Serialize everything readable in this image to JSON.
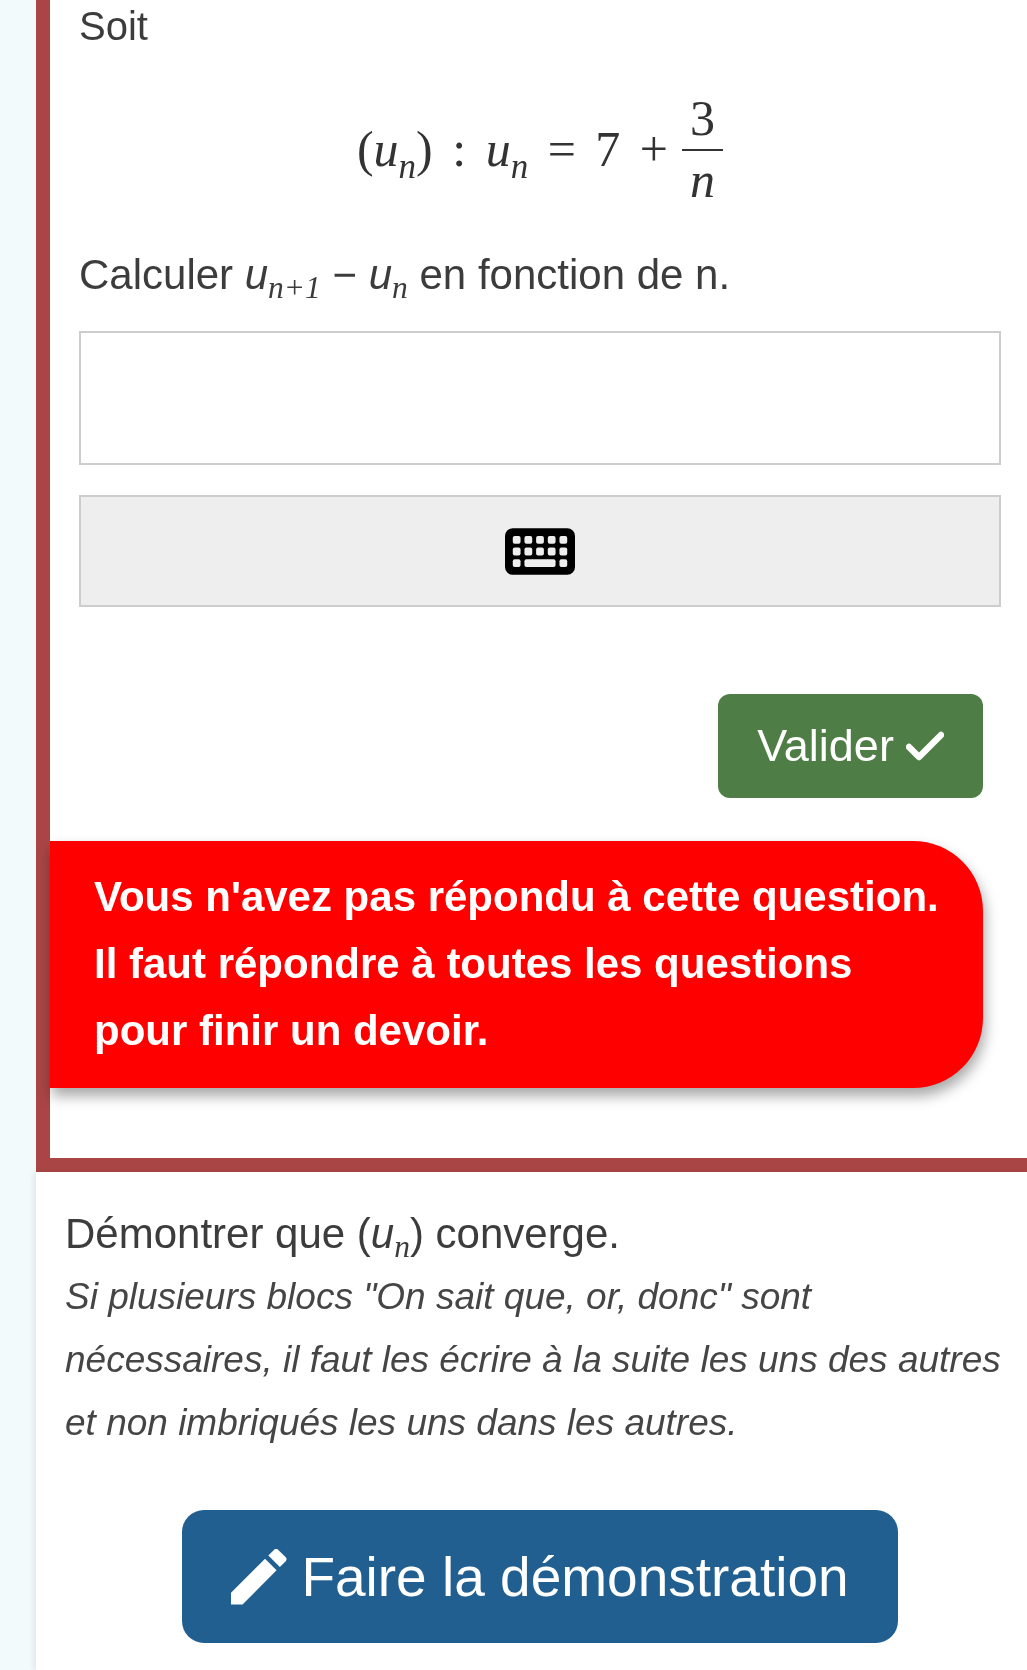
{
  "question": {
    "intro": "Soit",
    "formula": {
      "expression": "(*u*$_{n}$) : *u*$_{n}$ = 7 +",
      "numerator": "3",
      "denominator": "n"
    },
    "prompt": "Calculer *u*$_{n+1}$ − *u*$_{n}$ en fonction de n.",
    "submit_button": {
      "label": "Valider"
    },
    "alert": {
      "sentences": [
        "Vous n'avez pas répondu à cette question.",
        "Il faut répondre à toutes les questions pour finir un devoir."
      ]
    }
  },
  "next_question": {
    "prompt": "Démontrer que (*u*$_{n}$) converge.",
    "note": "Si plusieurs blocs \"On sait que, or, donc\" sont nécessaires, il faut les écrire à la suite les uns des autres et non imbriqués les uns dans les autres.",
    "button": {
      "label": "Faire la démonstration"
    }
  }
}
